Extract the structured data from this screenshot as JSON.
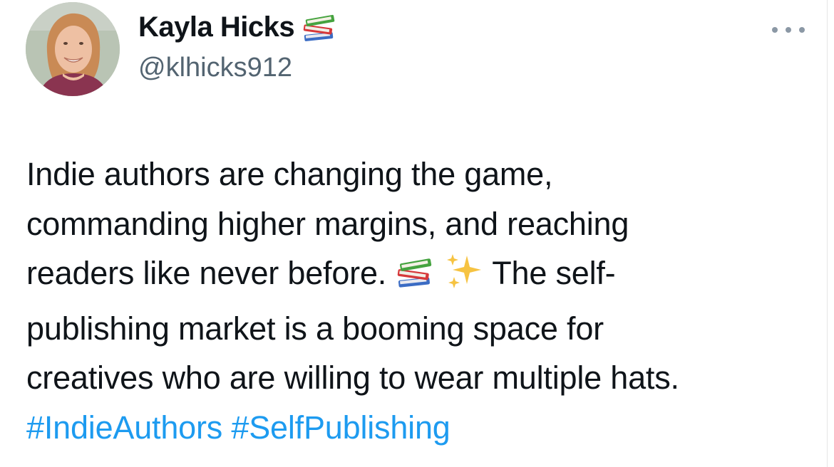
{
  "author": {
    "display_name": "Kayla Hicks",
    "handle": "@klhicks912",
    "name_emoji": "books-icon"
  },
  "menu": {
    "icon": "more-horizontal-icon"
  },
  "tweet": {
    "line1": "Indie authors are changing the game,",
    "line2": "commanding higher margins, and reaching",
    "line3_before": "readers like never before.",
    "line3_after": "The self-",
    "line4": "publishing market is a booming space for",
    "line5": "creatives who are willing to wear multiple hats.",
    "hashtags": [
      "#IndieAuthors",
      "#SelfPublishing"
    ],
    "emojis": [
      "books-icon",
      "sparkles-icon"
    ]
  },
  "colors": {
    "text": "#0f1419",
    "secondary": "#536471",
    "link": "#1d9bf0"
  }
}
